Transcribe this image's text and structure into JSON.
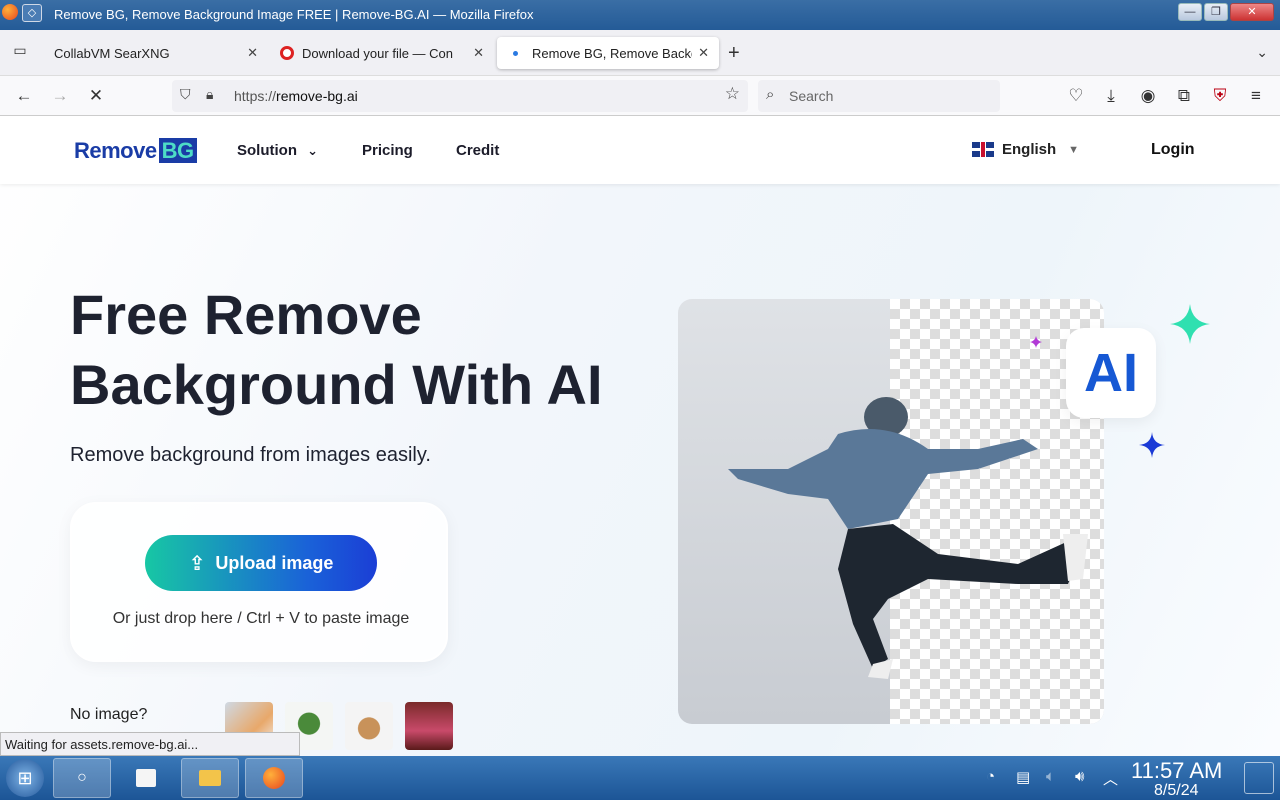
{
  "window": {
    "title": "Remove BG, Remove Background Image FREE | Remove-BG.AI — Mozilla Firefox",
    "minimize": "—",
    "maximize": "❐",
    "close": "✕"
  },
  "tabs": [
    {
      "label": "CollabVM SearXNG",
      "close": "✕"
    },
    {
      "label": "Download your file — Con",
      "close": "✕"
    },
    {
      "label": "Remove BG, Remove Backg",
      "close": "✕"
    }
  ],
  "navbar": {
    "url_prefix": "https://",
    "url_host": "remove-bg.ai",
    "search_placeholder": "Search"
  },
  "site": {
    "logo_text": "Remove",
    "logo_badge": "BG",
    "menu": {
      "solution": "Solution",
      "pricing": "Pricing",
      "credit": "Credit"
    },
    "language": "English",
    "login": "Login"
  },
  "hero": {
    "title_line1": "Free Remove",
    "title_line2": "Background With AI",
    "subtitle": "Remove background from images easily.",
    "upload_button": "Upload image",
    "drop_hint": "Or just drop here / Ctrl + V to paste image",
    "no_image": "No image?",
    "ai_badge": "AI"
  },
  "status": {
    "text": "Waiting for assets.remove-bg.ai..."
  },
  "taskbar": {
    "time": "11:57 AM",
    "date": "8/5/24"
  },
  "colors": {
    "brand": "#1a3ca6",
    "upload_gradient_start": "#17c7a4",
    "upload_gradient_end": "#1b3ed6",
    "ai_text": "#1658d4"
  }
}
